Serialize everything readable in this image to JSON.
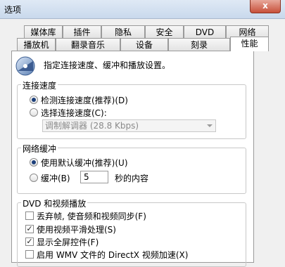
{
  "window": {
    "title": "选项",
    "close_glyph": "x"
  },
  "tabs_row1": [
    "媒体库",
    "插件",
    "隐私",
    "安全",
    "DVD",
    "网络"
  ],
  "tabs_row2": [
    "播放机",
    "翻录音乐",
    "设备",
    "刻录",
    "性能"
  ],
  "active_tab": "性能",
  "header": {
    "description": "指定连接速度、缓冲和播放设置。",
    "icon": "gauge-icon"
  },
  "connection_speed": {
    "legend": "连接速度",
    "detect_label": "检测连接速度(推荐)(D)",
    "choose_label": "选择连接速度(C):",
    "selected_index": 0,
    "modem_value": "调制解调器 (28.8 Kbps)"
  },
  "network_buffering": {
    "legend": "网络缓冲",
    "default_label": "使用默认缓冲(推荐)(U)",
    "buffer_label": "缓冲(B)",
    "buffer_seconds": "5",
    "seconds_suffix": "秒的内容",
    "selected_index": 0
  },
  "dvd_video": {
    "legend": "DVD 和视频播放",
    "options": [
      {
        "label": "丢弃帧, 使音频和视频同步(F)",
        "checked": false
      },
      {
        "label": "使用视频平滑处理(S)",
        "checked": true
      },
      {
        "label": "显示全屏控件(F)",
        "checked": true
      },
      {
        "label": "启用 WMV 文件的 DirectX 视频加速(X)",
        "checked": false
      }
    ]
  },
  "colors": {
    "title_bar_top": "#dfe9f5",
    "close_button": "#c7503a",
    "radio_dot": "#1c3f7a"
  }
}
